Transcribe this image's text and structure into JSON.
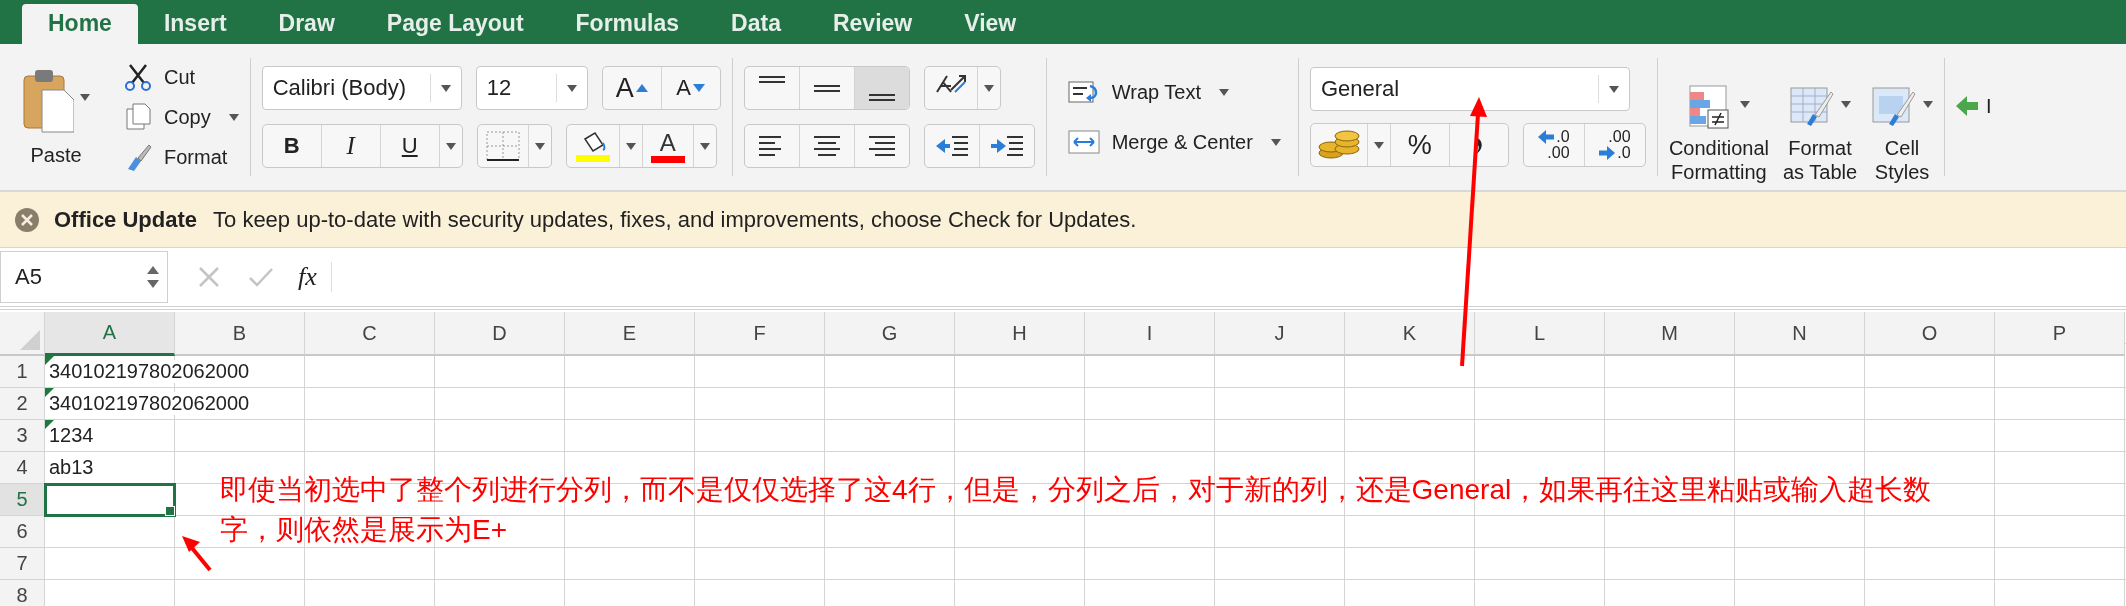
{
  "tabs": [
    {
      "label": "Home",
      "selected": true
    },
    {
      "label": "Insert",
      "selected": false
    },
    {
      "label": "Draw",
      "selected": false
    },
    {
      "label": "Page Layout",
      "selected": false
    },
    {
      "label": "Formulas",
      "selected": false
    },
    {
      "label": "Data",
      "selected": false
    },
    {
      "label": "Review",
      "selected": false
    },
    {
      "label": "View",
      "selected": false
    }
  ],
  "ribbon": {
    "clipboard": {
      "paste": "Paste",
      "cut": "Cut",
      "copy": "Copy",
      "format": "Format"
    },
    "font": {
      "name": "Calibri (Body)",
      "size": "12",
      "grow": "A",
      "shrink": "A",
      "bold": "B",
      "italic": "I",
      "underline": "U",
      "font_color": "A"
    },
    "vertical_align": [
      {
        "selected": false
      },
      {
        "selected": false
      },
      {
        "selected": true
      }
    ],
    "wrap_text": "Wrap Text",
    "merge_center": "Merge & Center",
    "number_format": "General",
    "percent": "%",
    "increase_decimal": [
      ".0",
      ".00"
    ],
    "decrease_decimal": [
      ".00",
      ".0"
    ],
    "styles": [
      {
        "kind": "conditional",
        "lines": [
          "Conditional",
          "Formatting"
        ]
      },
      {
        "kind": "table",
        "lines": [
          "Format",
          "as Table"
        ]
      },
      {
        "kind": "cell",
        "lines": [
          "Cell",
          "Styles"
        ]
      }
    ],
    "cells": "I"
  },
  "update_bar": {
    "title": "Office Update",
    "message": "To keep up-to-date with security updates, fixes, and improvements, choose Check for Updates."
  },
  "formula_bar": {
    "name_box": "A5",
    "fx": "fx"
  },
  "sheet": {
    "columns": [
      {
        "label": "A",
        "selected": true
      },
      {
        "label": "B",
        "selected": false
      },
      {
        "label": "C",
        "selected": false
      },
      {
        "label": "D",
        "selected": false
      },
      {
        "label": "E",
        "selected": false
      },
      {
        "label": "F",
        "selected": false
      },
      {
        "label": "G",
        "selected": false
      },
      {
        "label": "H",
        "selected": false
      },
      {
        "label": "I",
        "selected": false
      },
      {
        "label": "J",
        "selected": false
      },
      {
        "label": "K",
        "selected": false
      },
      {
        "label": "L",
        "selected": false
      },
      {
        "label": "M",
        "selected": false
      },
      {
        "label": "N",
        "selected": false
      },
      {
        "label": "O",
        "selected": false
      },
      {
        "label": "P",
        "selected": false
      }
    ],
    "rows": [
      {
        "label": "1",
        "selected": false,
        "cells": [
          {
            "value": "340102197802062000",
            "flagged": true,
            "selected": false
          }
        ]
      },
      {
        "label": "2",
        "selected": false,
        "cells": [
          {
            "value": "340102197802062000",
            "flagged": true,
            "selected": false
          }
        ]
      },
      {
        "label": "3",
        "selected": false,
        "cells": [
          {
            "value": "1234",
            "flagged": true,
            "selected": false
          }
        ]
      },
      {
        "label": "4",
        "selected": false,
        "cells": [
          {
            "value": "ab13",
            "flagged": false,
            "selected": false
          }
        ]
      },
      {
        "label": "5",
        "selected": true,
        "cells": [
          {
            "flagged": false,
            "selected": true
          }
        ]
      },
      {
        "label": "6",
        "selected": false,
        "cells": []
      },
      {
        "label": "7",
        "selected": false,
        "cells": []
      },
      {
        "label": "8",
        "selected": false,
        "cells": []
      }
    ]
  },
  "annotation": "即使当初选中了整个列进行分列，而不是仅仅选择了这4行，但是，分列之后，对于新的列，还是General，如果再往这里粘贴或输入超长数字，则依然是展示为E+"
}
